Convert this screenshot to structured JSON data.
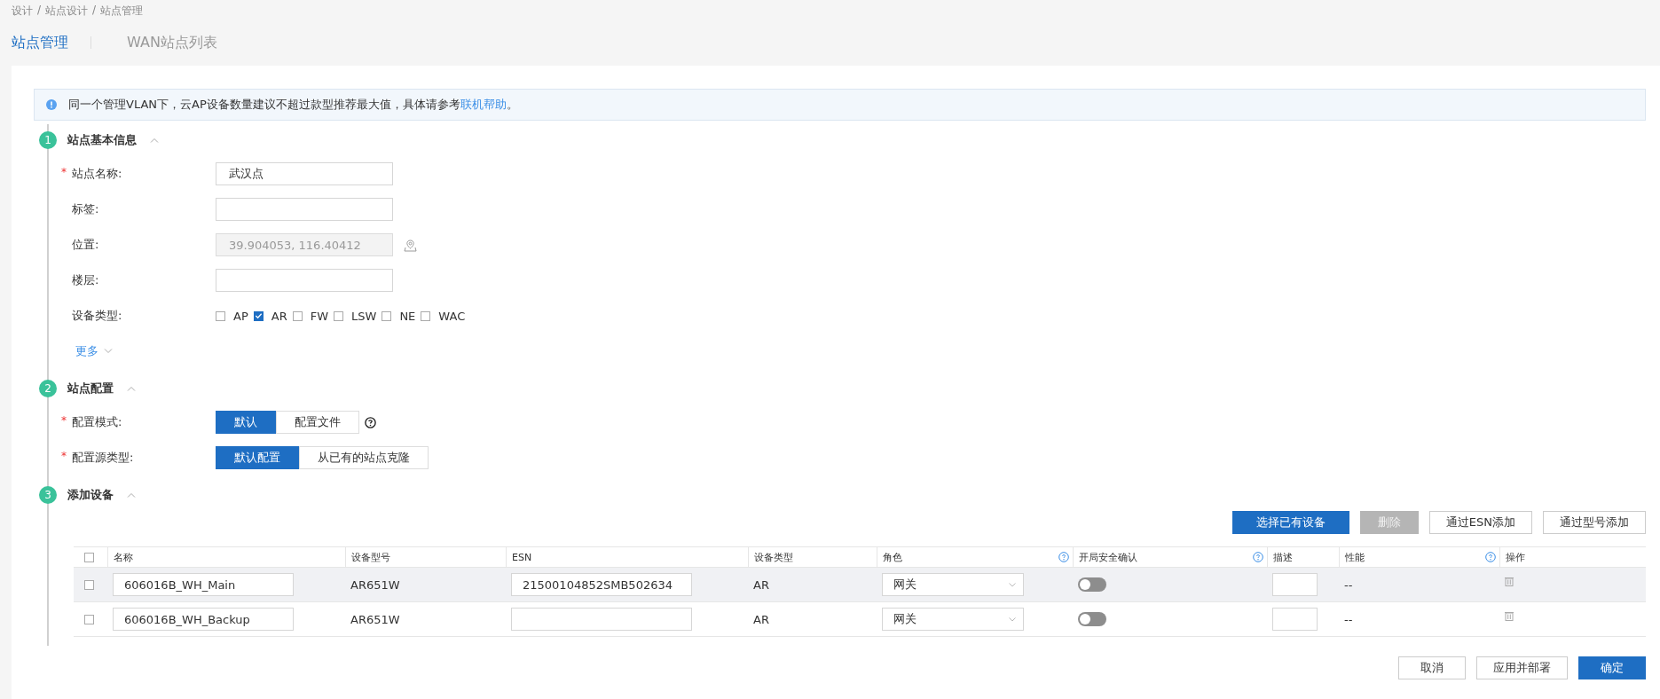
{
  "breadcrumb": [
    "设计",
    "站点设计",
    "站点管理"
  ],
  "required_mark": "*",
  "breadcrumb_separator": "/",
  "tabs": [
    {
      "label": "站点管理",
      "selected": true
    },
    {
      "label": "WAN站点列表",
      "selected": false
    }
  ],
  "notice": {
    "text": "同一个管理VLAN下，云AP设备数量建议不超过款型推荐最大值，具体请参考",
    "link": "联机帮助",
    "end": "。"
  },
  "sections": [
    {
      "number": "1",
      "title": "站点基本信息",
      "expanded": true,
      "fields": [
        {
          "kind": "text",
          "label": "站点名称:",
          "required": true,
          "value": "武汉点",
          "disabled": false
        },
        {
          "kind": "text",
          "label": "标签:",
          "required": false,
          "disabled": false
        },
        {
          "kind": "location",
          "label": "位置:",
          "required": false,
          "value": "39.904053, 116.40412",
          "disabled": true
        },
        {
          "kind": "text",
          "label": "楼层:",
          "required": false,
          "disabled": false
        },
        {
          "kind": "checkboxes",
          "label": "设备类型:",
          "required": false,
          "options": [
            {
              "label": "AP",
              "checked": false
            },
            {
              "label": "AR",
              "checked": true
            },
            {
              "label": "FW",
              "checked": false
            },
            {
              "label": "LSW",
              "checked": false
            },
            {
              "label": "NE",
              "checked": false
            },
            {
              "label": "WAC",
              "checked": false
            }
          ]
        },
        {
          "kind": "more",
          "label": "更多"
        }
      ]
    },
    {
      "number": "2",
      "title": "站点配置",
      "expanded": true,
      "fields": [
        {
          "kind": "segmented",
          "label": "配置模式:",
          "required": true,
          "help": true,
          "options": [
            {
              "label": "默认",
              "selected": true
            },
            {
              "label": "配置文件",
              "selected": false
            }
          ]
        },
        {
          "kind": "segmented",
          "label": "配置源类型:",
          "required": true,
          "help": false,
          "options": [
            {
              "label": "默认配置",
              "selected": true
            },
            {
              "label": "从已有的站点克隆",
              "selected": false
            }
          ]
        }
      ]
    },
    {
      "number": "3",
      "title": "添加设备",
      "expanded": true
    }
  ],
  "device_actions": [
    {
      "label": "选择已有设备",
      "kind": "primary"
    },
    {
      "label": "删除",
      "kind": "disabled"
    },
    {
      "label": "通过ESN添加",
      "kind": "default"
    },
    {
      "label": "通过型号添加",
      "kind": "default"
    }
  ],
  "table": {
    "select_all_checked": false,
    "columns": [
      {
        "label": "名称",
        "help": false
      },
      {
        "label": "设备型号",
        "help": false
      },
      {
        "label": "ESN",
        "help": false
      },
      {
        "label": "设备类型",
        "help": false
      },
      {
        "label": "角色",
        "help": true
      },
      {
        "label": "开局安全确认",
        "help": true
      },
      {
        "label": "描述",
        "help": false
      },
      {
        "label": "性能",
        "help": true
      },
      {
        "label": "操作",
        "help": false
      }
    ],
    "rows": [
      {
        "checked": false,
        "highlighted": true,
        "name": "606016B_WH_Main",
        "model": "AR651W",
        "esn": "21500104852SMB502634",
        "type": "AR",
        "role": "网关",
        "secure_on": false,
        "performance": "--"
      },
      {
        "checked": false,
        "highlighted": false,
        "name": "606016B_WH_Backup",
        "model": "AR651W",
        "type": "AR",
        "role": "网关",
        "secure_on": false,
        "performance": "--"
      }
    ]
  },
  "footer_buttons": [
    {
      "label": "取消",
      "kind": "default"
    },
    {
      "label": "应用并部署",
      "kind": "default"
    },
    {
      "label": "确定",
      "kind": "primary"
    }
  ]
}
